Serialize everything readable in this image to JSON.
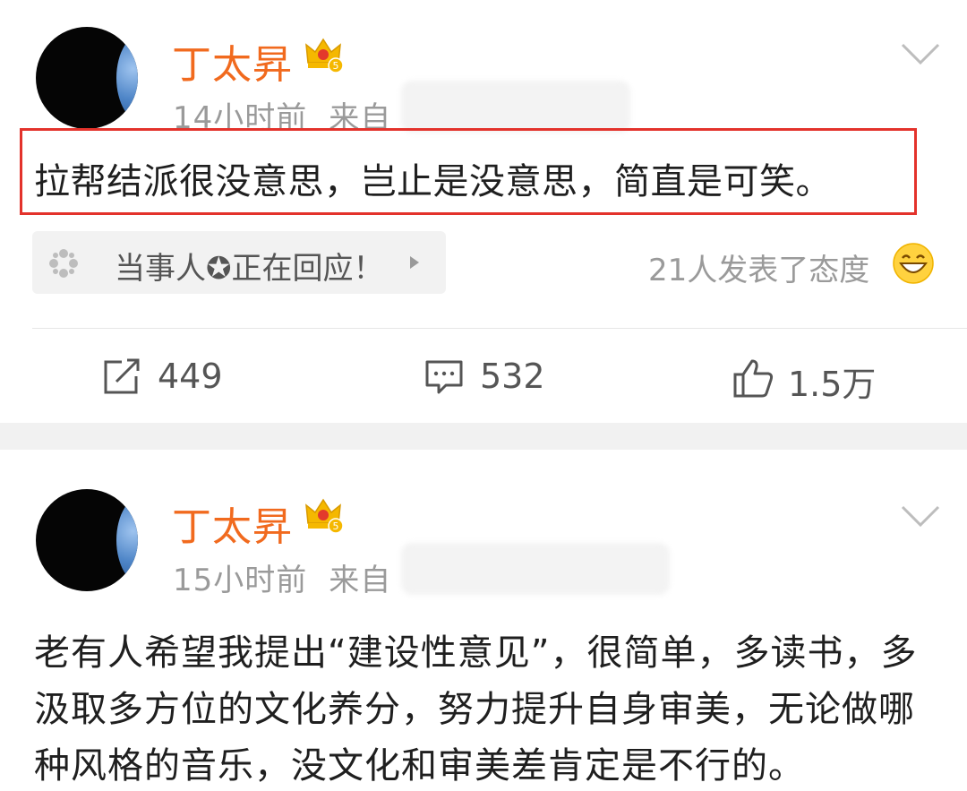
{
  "posts": [
    {
      "author": "丁太昇",
      "time": "14小时前",
      "source_prefix": "来自",
      "text": "拉帮结派很没意思，岂止是没意思，简直是可笑。",
      "tag": "当事人✪正在回应！",
      "reactions": "21人发表了态度",
      "actions": {
        "repost": "449",
        "comment": "532",
        "like": "1.5万"
      }
    },
    {
      "author": "丁太昇",
      "time": "15小时前",
      "source_prefix": "来自",
      "text": "老有人希望我提出“建设性意见”，很简单，多读书，多汲取多方位的文化养分，努力提升自身审美，无论做哪种风格的音乐，没文化和审美差肯定是不行的。"
    }
  ],
  "colors": {
    "author": "#f16a1e",
    "highlight": "#e3322b",
    "meta": "#9a9a9a"
  },
  "icons": [
    "avatar",
    "crown-badge-icon",
    "chevron-down-icon",
    "sparkle-icon",
    "play-arrow-icon",
    "grin-emoji-icon",
    "repost-icon",
    "comment-icon",
    "thumbs-up-icon"
  ]
}
